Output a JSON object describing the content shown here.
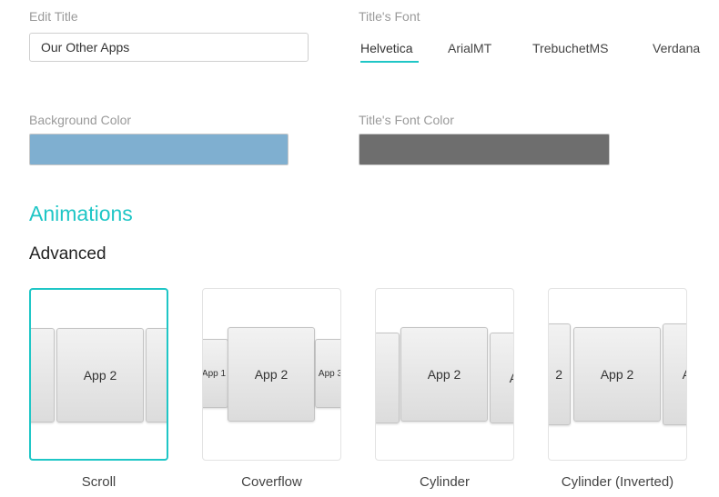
{
  "edit_title": {
    "label": "Edit Title",
    "value": "Our Other Apps"
  },
  "title_font": {
    "label": "Title's Font",
    "options": [
      "Helvetica",
      "ArialMT",
      "TrebuchetMS",
      "Verdana"
    ],
    "selected": "Helvetica"
  },
  "background_color": {
    "label": "Background Color",
    "value": "#7fafd0"
  },
  "title_font_color": {
    "label": "Title's Font Color",
    "value": "#6e6e6e"
  },
  "animations": {
    "heading": "Animations",
    "subheading": "Advanced",
    "selected": "Scroll",
    "options": [
      {
        "label": "Scroll",
        "tiles": [
          "App 2"
        ]
      },
      {
        "label": "Coverflow",
        "tiles": [
          "App 1",
          "App 2",
          "App 3"
        ]
      },
      {
        "label": "Cylinder",
        "tiles": [
          "App 2",
          "A"
        ]
      },
      {
        "label": "Cylinder (Inverted)",
        "tiles": [
          "2",
          "App 2",
          "A"
        ]
      }
    ]
  },
  "colors": {
    "accent": "#1fc6c6"
  }
}
